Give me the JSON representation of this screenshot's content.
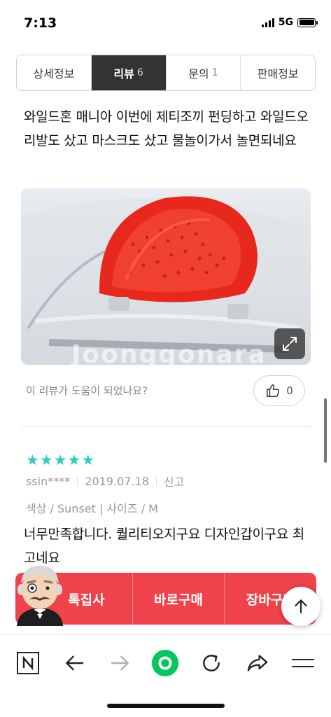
{
  "status_bar": {
    "time": "7:13",
    "network": "5G",
    "signal_bars": 4,
    "battery_level": 1.0
  },
  "tabs": [
    {
      "label": "상세정보",
      "count": ""
    },
    {
      "label": "리뷰",
      "count": "6",
      "active": true
    },
    {
      "label": "문의",
      "count": "1"
    },
    {
      "label": "판매정보",
      "count": ""
    }
  ],
  "review1": {
    "text": "와일드혼 매니아 이번에 제티조끼 펀딩하고 와일드오리발도 샀고 마스크도 샀고 물놀이가서 놀면되네요",
    "photo_watermark": "Joonggonara",
    "photo_icon": "expand-icon"
  },
  "helpful": {
    "question": "이 리뷰가 도움이 되었나요?",
    "count": "0",
    "icon": "thumbs-up-icon"
  },
  "review2": {
    "rating": 5,
    "star_color": "#2ecfbf",
    "author": "ssin****",
    "date": "2019.07.18",
    "report_label": "신고",
    "option": "색상 / Sunset | 사이즈 / M",
    "text": "너무만족합니다. 퀄리티오지구요 디자인갑이구요 최고네요"
  },
  "purchase_bar": {
    "color": "#f0424b",
    "buttons": [
      "톡집사",
      "바로구매",
      "장바구니"
    ]
  },
  "top_button_icon": "arrow-up-icon",
  "toolbar": {
    "items": [
      "naver-home-icon",
      "back-arrow-icon",
      "forward-arrow-icon",
      "green-dot-icon",
      "refresh-icon",
      "share-icon",
      "menu-icon"
    ],
    "accent": "#03c75a"
  }
}
